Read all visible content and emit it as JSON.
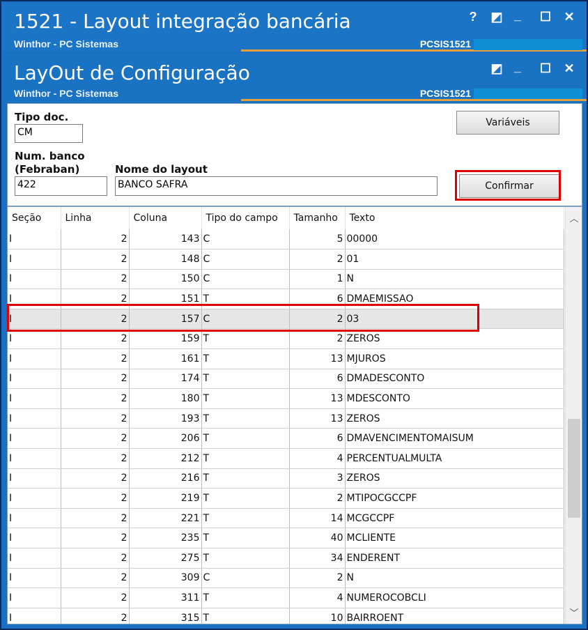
{
  "window1": {
    "title": "1521 - Layout integração bancária",
    "subtitle": "Winthor - PC Sistemas",
    "code": "PCSIS1521",
    "controls": [
      "?",
      "◩",
      "_",
      "☐",
      "✕"
    ]
  },
  "window2": {
    "title": "LayOut de Configuração",
    "subtitle": "Winthor - PC Sistemas",
    "code": "PCSIS1521",
    "controls": [
      "◩",
      "_",
      "☐",
      "✕"
    ]
  },
  "form": {
    "tipo_doc_label": "Tipo doc.",
    "tipo_doc_value": "CM",
    "num_banco_label_1": "Num. banco",
    "num_banco_label_2": "(Febraban)",
    "num_banco_value": "422",
    "nome_layout_label": "Nome do layout",
    "nome_layout_value": "BANCO SAFRA",
    "variaveis_label": "Variáveis",
    "confirmar_label": "Confirmar"
  },
  "table": {
    "columns": [
      "Seção",
      "Linha",
      "Coluna",
      "Tipo do campo",
      "Tamanho",
      "Texto"
    ],
    "selected_row": 4,
    "rows": [
      [
        "I",
        "2",
        "143",
        "C",
        "5",
        "00000"
      ],
      [
        "I",
        "2",
        "148",
        "C",
        "2",
        "01"
      ],
      [
        "I",
        "2",
        "150",
        "C",
        "1",
        "N"
      ],
      [
        "I",
        "2",
        "151",
        "T",
        "6",
        "DMAEMISSAO"
      ],
      [
        "I",
        "2",
        "157",
        "C",
        "2",
        "03"
      ],
      [
        "I",
        "2",
        "159",
        "T",
        "2",
        "ZEROS"
      ],
      [
        "I",
        "2",
        "161",
        "T",
        "13",
        "MJUROS"
      ],
      [
        "I",
        "2",
        "174",
        "T",
        "6",
        "DMADESCONTO"
      ],
      [
        "I",
        "2",
        "180",
        "T",
        "13",
        "MDESCONTO"
      ],
      [
        "I",
        "2",
        "193",
        "T",
        "13",
        "ZEROS"
      ],
      [
        "I",
        "2",
        "206",
        "T",
        "6",
        "DMAVENCIMENTOMAISUM"
      ],
      [
        "I",
        "2",
        "212",
        "T",
        "4",
        "PERCENTUALMULTA"
      ],
      [
        "I",
        "2",
        "216",
        "T",
        "3",
        "ZEROS"
      ],
      [
        "I",
        "2",
        "219",
        "T",
        "2",
        "MTIPOCGCCPF"
      ],
      [
        "I",
        "2",
        "221",
        "T",
        "14",
        "MCGCCPF"
      ],
      [
        "I",
        "2",
        "235",
        "T",
        "40",
        "MCLIENTE"
      ],
      [
        "I",
        "2",
        "275",
        "T",
        "34",
        "ENDERENT"
      ],
      [
        "I",
        "2",
        "309",
        "C",
        "2",
        " N"
      ],
      [
        "I",
        "2",
        "311",
        "T",
        "4",
        "NUMEROCOBCLI"
      ],
      [
        "I",
        "2",
        "315",
        "T",
        "10",
        "BAIRROENT"
      ]
    ]
  }
}
